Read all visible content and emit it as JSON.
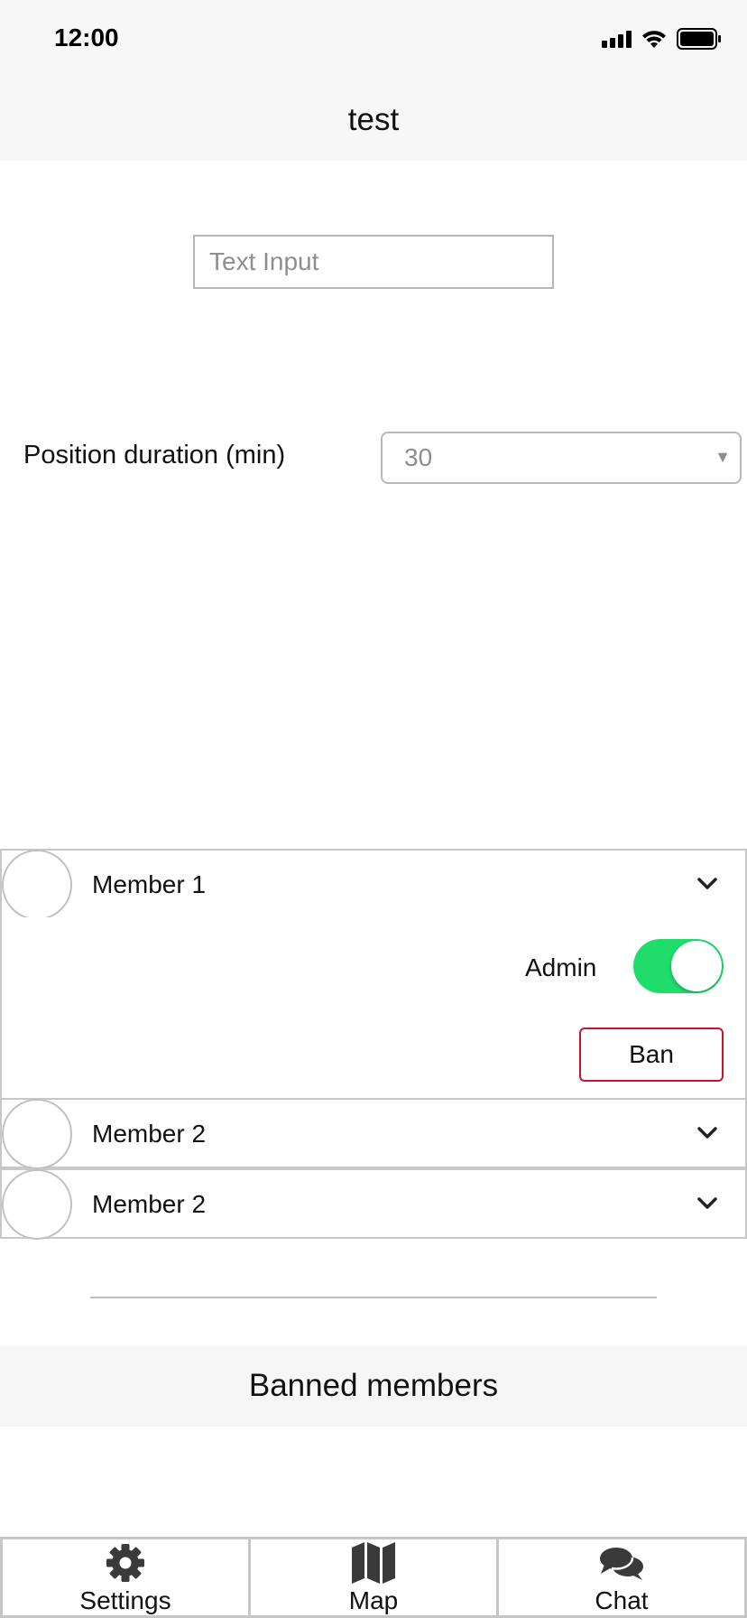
{
  "status_bar": {
    "time": "12:00",
    "icons": [
      "cellular-signal-icon",
      "wifi-icon",
      "battery-icon"
    ]
  },
  "header": {
    "title": "test"
  },
  "text_input": {
    "placeholder": "Text Input",
    "value": ""
  },
  "duration": {
    "label": "Position duration (min)",
    "selected": "30"
  },
  "members": [
    {
      "name": "Member 1",
      "expanded": true
    },
    {
      "name": "Member 2",
      "expanded": false
    },
    {
      "name": "Member 2",
      "expanded": false
    }
  ],
  "member_details": {
    "admin_label": "Admin",
    "admin_enabled": true,
    "ban_label": "Ban"
  },
  "banned_section": {
    "title": "Banned members"
  },
  "tab_bar": {
    "tabs": [
      {
        "label": "Settings",
        "icon": "gear-icon"
      },
      {
        "label": "Map",
        "icon": "map-icon"
      },
      {
        "label": "Chat",
        "icon": "chat-bubbles-icon"
      }
    ]
  },
  "colors": {
    "toggle_on": "#1fdc6b",
    "ban_border": "#d0112b",
    "header_bg": "#f7f7f7"
  }
}
